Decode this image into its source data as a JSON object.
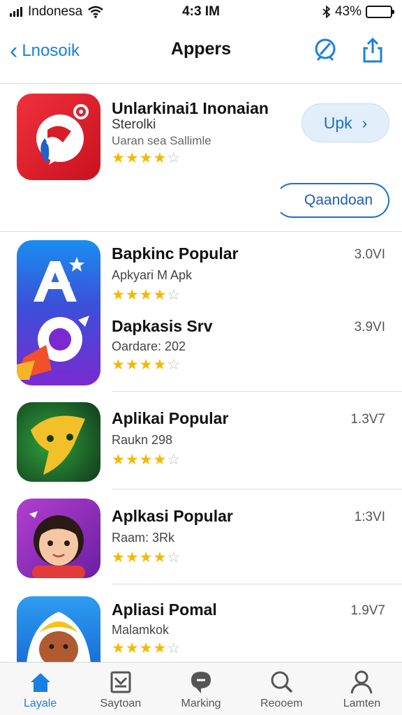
{
  "status_bar": {
    "carrier": "Indonesa",
    "time": "4:3 IM",
    "battery": "43%",
    "battery_level": 0.43
  },
  "nav": {
    "back_label": "Lnosoik",
    "title": "Appers"
  },
  "featured": {
    "title": "Unlarkinai1 Inonaian",
    "subtitle": "Sterolki",
    "meta": "Uaran  sea Sallimle",
    "rating": 4,
    "get_label": "Upk",
    "download_label": "Qaandoan"
  },
  "apps": [
    {
      "title": "Bapkinc Popular",
      "subtitle": "Apkyari M  Apk",
      "size": "3.0VI",
      "rating": 4
    },
    {
      "title": "Dapkasis Srv",
      "subtitle": "Oardare: 202",
      "size": "3.9VI",
      "rating": 4
    },
    {
      "title": "Aplikai Popular",
      "subtitle": "Raukn 298",
      "size": "1.3V7",
      "rating": 4
    },
    {
      "title": "Aplkasi Popular",
      "subtitle": "Raam: 3Rk",
      "size": "1:3VI",
      "rating": 4
    },
    {
      "title": "Apliasi Pomal",
      "subtitle": "Malamkok",
      "size": "1.9V7",
      "rating": 4
    }
  ],
  "tabs": [
    {
      "label": "Layale",
      "icon": "home-icon"
    },
    {
      "label": "Saytoan",
      "icon": "inbox-icon"
    },
    {
      "label": "Marking",
      "icon": "chat-icon"
    },
    {
      "label": "Reooem",
      "icon": "search-icon"
    },
    {
      "label": "Lamten",
      "icon": "person-icon"
    }
  ],
  "colors": {
    "accent": "#1a7fe0",
    "star": "#f5b800",
    "battery": "#2fc84a"
  }
}
